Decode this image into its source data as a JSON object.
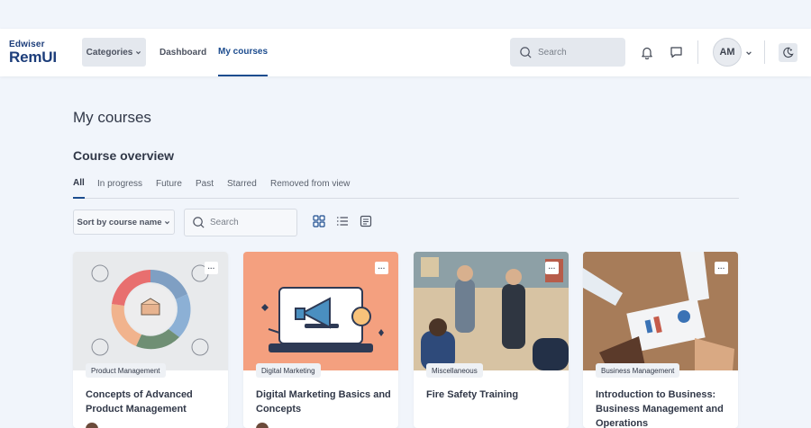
{
  "brand": {
    "line1": "Edwiser",
    "line2": "RemUI"
  },
  "nav": {
    "categories_label": "Categories",
    "links": [
      {
        "label": "Dashboard"
      },
      {
        "label": "My courses"
      }
    ],
    "search_placeholder": "Search",
    "user_initials": "AM"
  },
  "page": {
    "title": "My courses",
    "overview_title": "Course overview",
    "tabs": [
      {
        "label": "All"
      },
      {
        "label": "In progress"
      },
      {
        "label": "Future"
      },
      {
        "label": "Past"
      },
      {
        "label": "Starred"
      },
      {
        "label": "Removed from view"
      }
    ],
    "sort_label": "Sort by course name",
    "search_placeholder": "Search"
  },
  "courses": [
    {
      "category": "Product Management",
      "title": "Concepts of Advanced Product Management"
    },
    {
      "category": "Digital Marketing",
      "title": "Digital Marketing Basics and Concepts"
    },
    {
      "category": "Miscellaneous",
      "title": "Fire Safety Training"
    },
    {
      "category": "Business Management",
      "title": "Introduction to Business: Business Management and Operations"
    }
  ],
  "colors": {
    "accent": "#1c4c8e",
    "page_bg": "#f1f5fb",
    "surface": "#ffffff"
  }
}
